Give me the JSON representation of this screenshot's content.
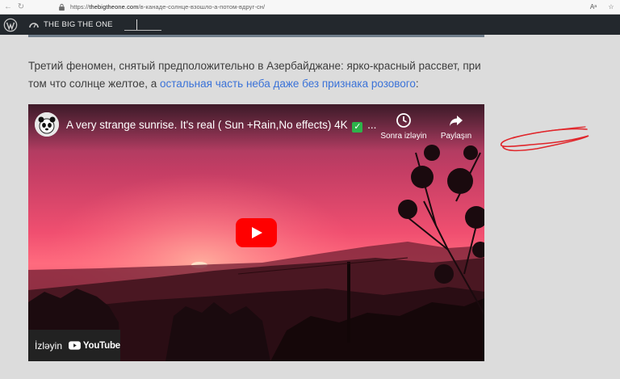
{
  "browser": {
    "url_prefix": "https://",
    "url_domain": "thebigtheone.com",
    "url_path": "/в-канаде-солнце-взошло-а-потом-вдруг-сн/",
    "reader_label": "Aᵃ"
  },
  "adminbar": {
    "site_title": "THE BIG THE ONE"
  },
  "article": {
    "text_before": "Третий феномен, снятый предположительно в Азербайджане: ярко-красный рассвет, при том что солнце желтое, а ",
    "link_text": "остальная часть неба даже без признака розового",
    "text_after": ":"
  },
  "video": {
    "title": "A very strange sunrise. It's real ( Sun +Rain,No effects) 4K",
    "title_check": "✓",
    "title_ellipsis": "...",
    "watch_later_label": "Sonra izləyin",
    "share_label": "Paylaşın",
    "watch_on_label": "İzləyin",
    "youtube_label": "YouTube"
  },
  "colors": {
    "link": "#3a72d8",
    "adminbar": "#23282d",
    "annotation": "#e0262b",
    "youtube_red": "#ff0000"
  }
}
